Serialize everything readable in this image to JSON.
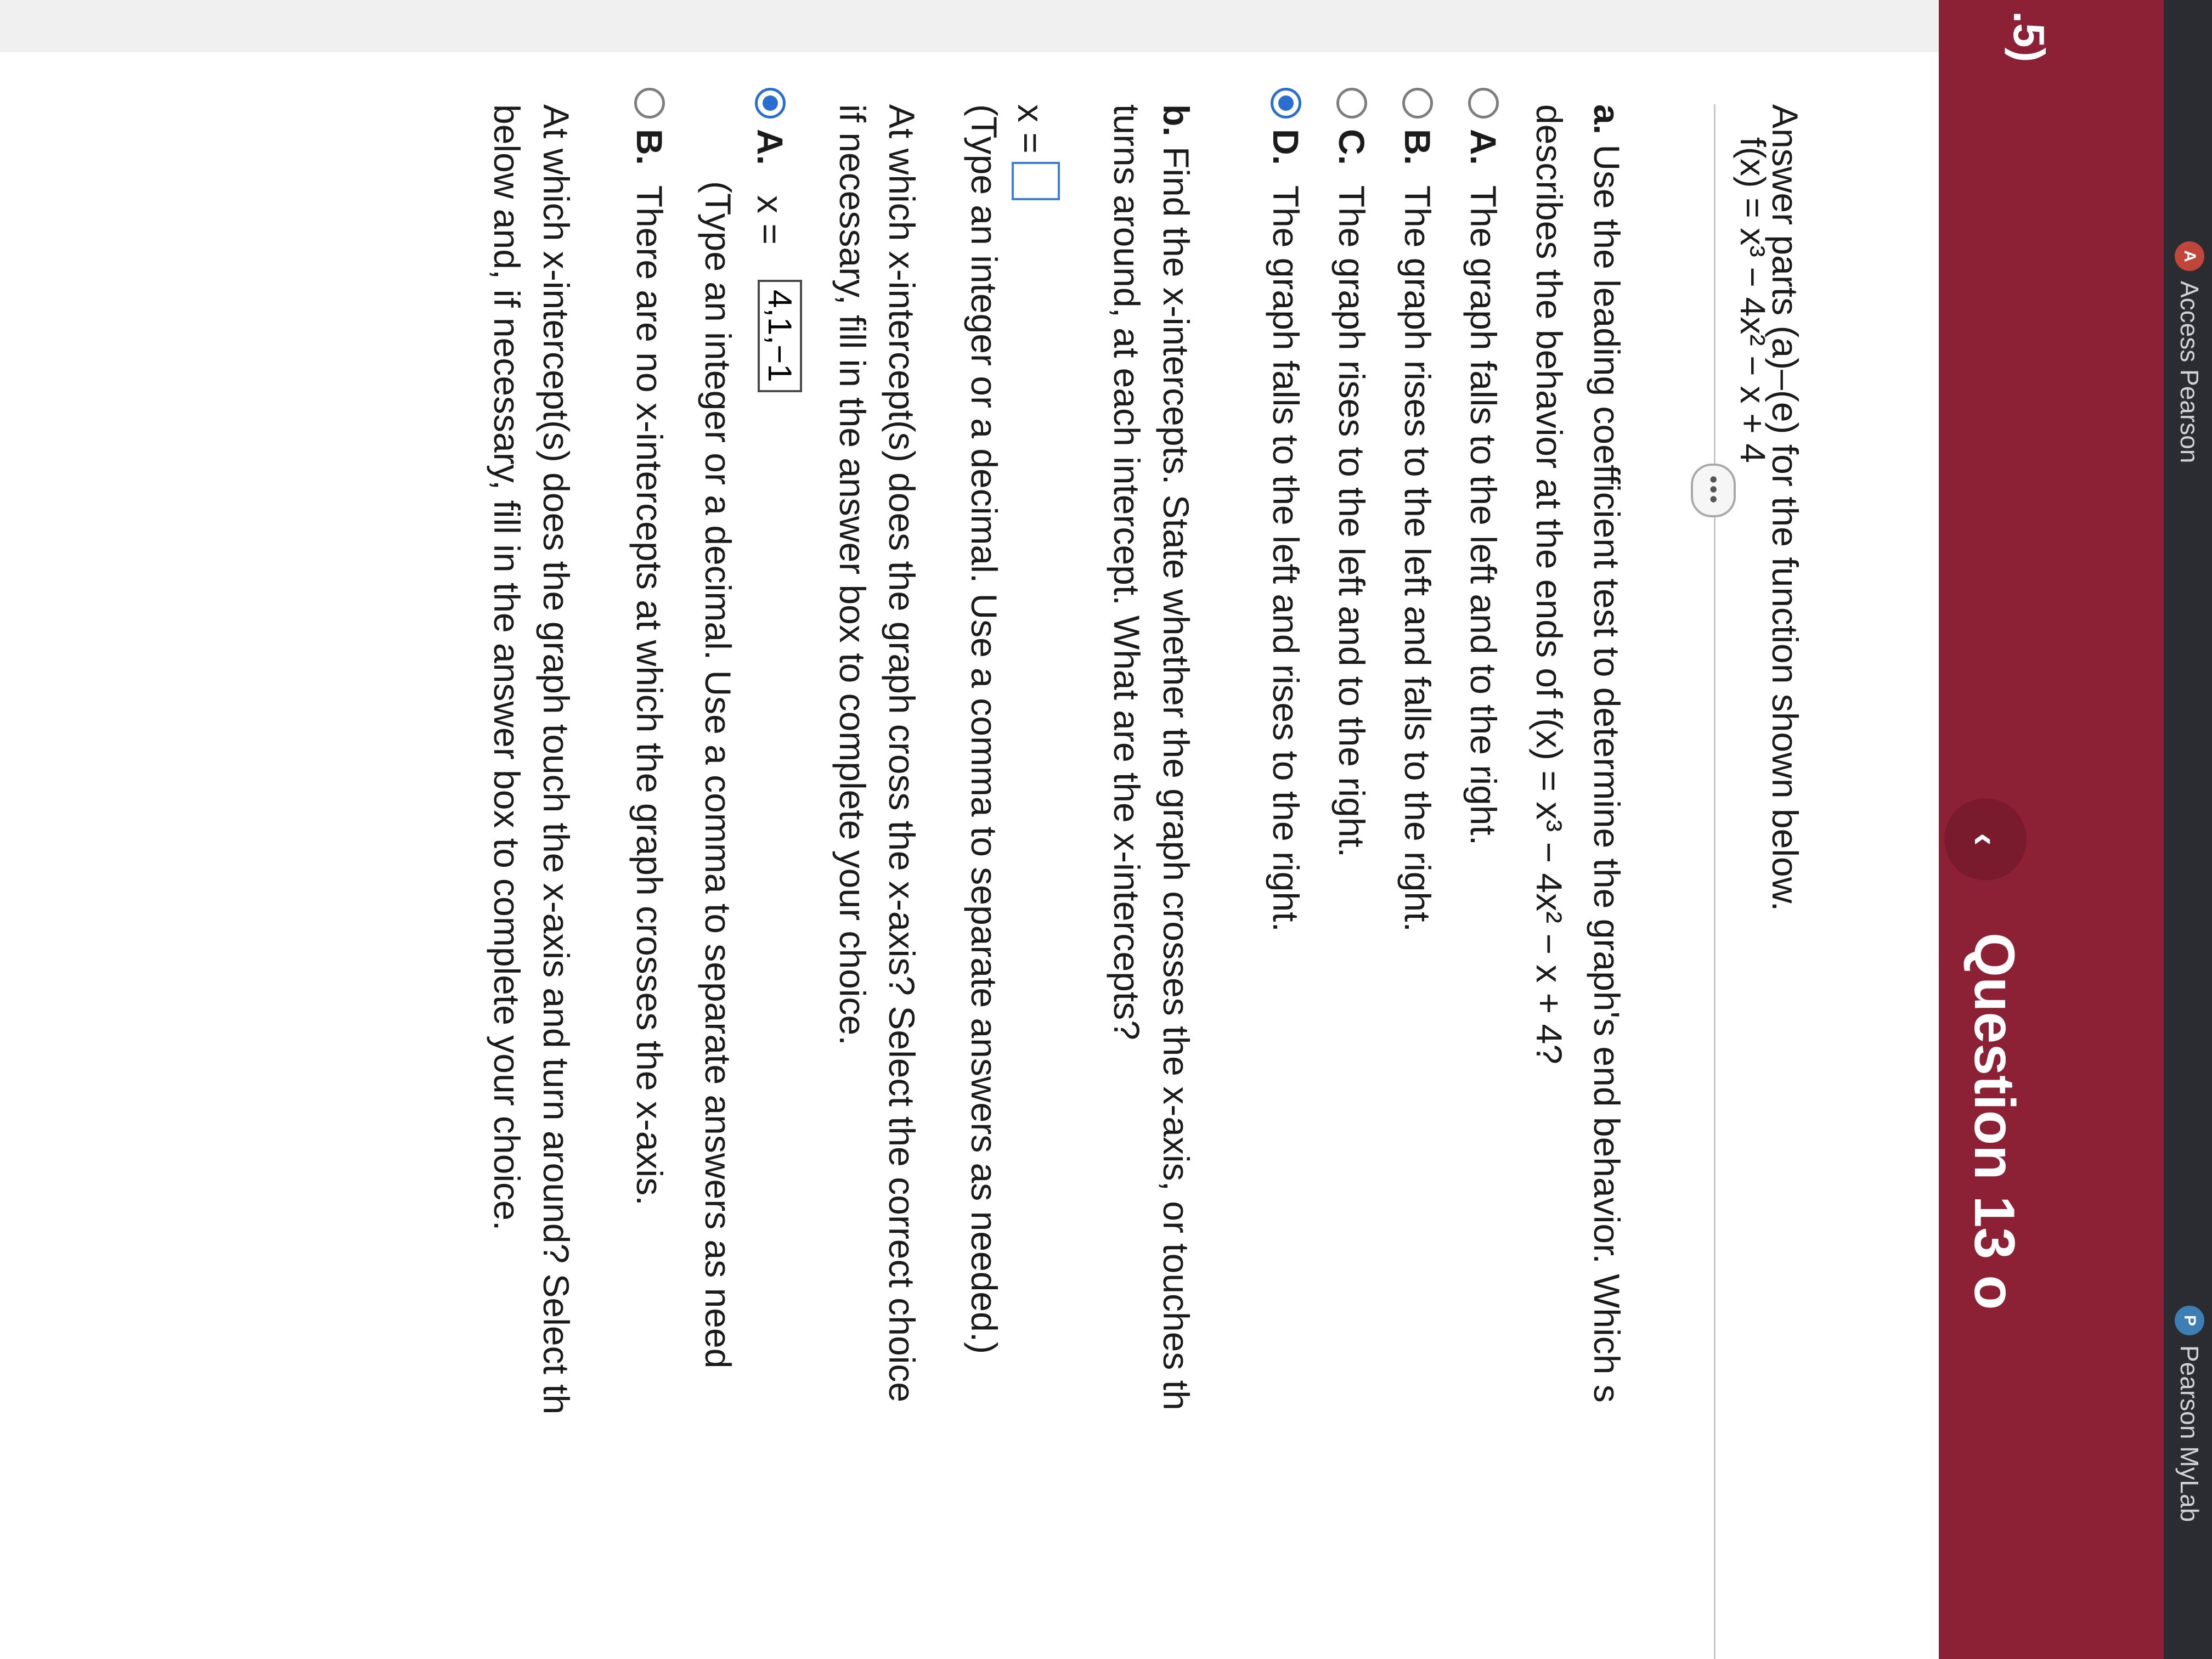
{
  "browser": {
    "tabs": [
      {
        "label": "Access Pearson",
        "icon_text": "A"
      },
      {
        "label": "Pearson MyLab",
        "icon_text": "P"
      }
    ]
  },
  "header": {
    "section": ".5)",
    "question_label": "Question 13 o",
    "prev_icon": "chevron-left"
  },
  "problem": {
    "instructions": "Answer parts (a)–(e) for the function shown below.",
    "function_text": "f(x) = x³ − 4x² − x + 4"
  },
  "part_a": {
    "label": "a.",
    "question_line1": "Use the leading coefficient test to determine the graph's end behavior. Which s",
    "question_line2": "describes the behavior at the ends of f(x) = x³ − 4x² − x + 4?",
    "options": [
      {
        "letter": "A.",
        "text": "The graph falls to the left and to the right.",
        "selected": false
      },
      {
        "letter": "B.",
        "text": "The graph rises to the left and falls to the right.",
        "selected": false
      },
      {
        "letter": "C.",
        "text": "The graph rises to the left and to the right.",
        "selected": false
      },
      {
        "letter": "D.",
        "text": "The graph falls to the left and rises to the right.",
        "selected": true
      }
    ]
  },
  "part_b": {
    "label": "b.",
    "question_line1": "Find the x-intercepts. State whether the graph crosses the x-axis, or touches th",
    "question_line2": "turns around, at each intercept. What are the x-intercepts?",
    "x_label": "x =",
    "hint": "(Type an integer or a decimal. Use a comma to separate answers as needed.)",
    "cross_question_line1": "At which x-intercept(s) does the graph cross the x-axis? Select the correct choice",
    "cross_question_line2": "if necessary, fill in the answer box to complete your choice.",
    "cross_options": [
      {
        "letter": "A.",
        "prefix": "x =",
        "value": "4,1,−1",
        "hint": "(Type an integer or a decimal. Use a comma to separate answers as need",
        "selected": true
      },
      {
        "letter": "B.",
        "text": "There are no x-intercepts at which the graph crosses the x-axis.",
        "selected": false
      }
    ],
    "touch_question_line1": "At which x-intercept(s) does the graph touch the x-axis and turn around? Select th",
    "touch_question_line2": "below and, if necessary, fill in the answer box to complete your choice."
  },
  "colors": {
    "header_bg": "#8c2035",
    "radio_selected": "#2a6fd0"
  }
}
